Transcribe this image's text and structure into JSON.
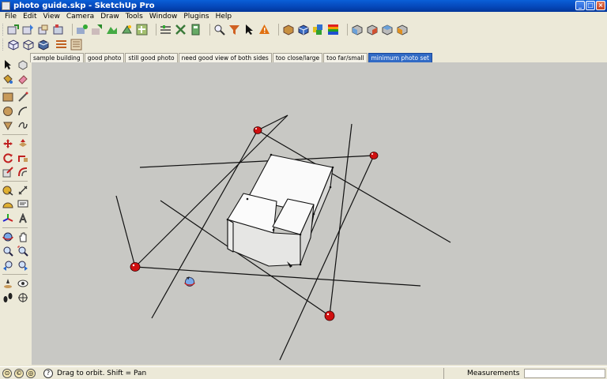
{
  "window": {
    "title": "photo guide.skp - SketchUp Pro"
  },
  "menu": [
    "File",
    "Edit",
    "View",
    "Camera",
    "Draw",
    "Tools",
    "Window",
    "Plugins",
    "Help"
  ],
  "scenes": [
    {
      "label": "sample building",
      "active": false
    },
    {
      "label": "good photo",
      "active": false
    },
    {
      "label": "still good photo",
      "active": false
    },
    {
      "label": "need good view of both sides",
      "active": false
    },
    {
      "label": "too close/large",
      "active": false
    },
    {
      "label": "too far/small",
      "active": false
    },
    {
      "label": "minimum photo set",
      "active": true
    }
  ],
  "status": {
    "hint": "Drag to orbit.  Shift = Pan",
    "measurements_label": "Measurements",
    "measurements_value": ""
  },
  "colors": {
    "viewport_bg": "#c8c8c4",
    "camera_marker": "#d01010",
    "active_scene_tab": "#316ac5",
    "title_bar": "#0546b8"
  },
  "icons": {
    "toolbar1": [
      "3d-warehouse-get-models-icon",
      "3d-warehouse-share-model-icon",
      "share-component-icon",
      "extension-warehouse-icon",
      "photo-textures-icon",
      "add-location-icon",
      "toggle-terrain-icon",
      "sandbox-tools-icon",
      "dynamic-components-interact-icon",
      "component-options-icon",
      "component-attributes-icon",
      "solid-tools-icon",
      "zoom-window-icon",
      "filter-icon",
      "select-pointer-icon",
      "warning-icon",
      "materials-icon",
      "components-icon",
      "styles-icon",
      "color-swatch-icon",
      "front-view-icon",
      "right-view-icon",
      "back-view-icon",
      "left-view-icon"
    ],
    "toolbar2": [
      "iso-view-icon",
      "wireframe-icon",
      "shaded-icon",
      "layers-icon",
      "outliner-icon"
    ],
    "left_tools": [
      "select-icon",
      "make-component-icon",
      "paint-bucket-icon",
      "eraser-icon",
      "rectangle-icon",
      "line-icon",
      "circle-icon",
      "arc-icon",
      "polygon-icon",
      "freehand-icon",
      "move-icon",
      "push-pull-icon",
      "rotate-icon",
      "follow-me-icon",
      "scale-icon",
      "offset-icon",
      "tape-measure-icon",
      "dimension-icon",
      "protractor-icon",
      "text-icon",
      "axes-icon",
      "3d-text-icon",
      "orbit-icon",
      "pan-icon",
      "zoom-icon",
      "zoom-extents-icon",
      "previous-view-icon",
      "next-view-icon",
      "position-camera-icon",
      "look-around-icon",
      "walk-icon",
      "section-plane-icon"
    ],
    "status": [
      "geo-location-icon",
      "credits-icon",
      "user-account-icon",
      "help-icon"
    ]
  }
}
